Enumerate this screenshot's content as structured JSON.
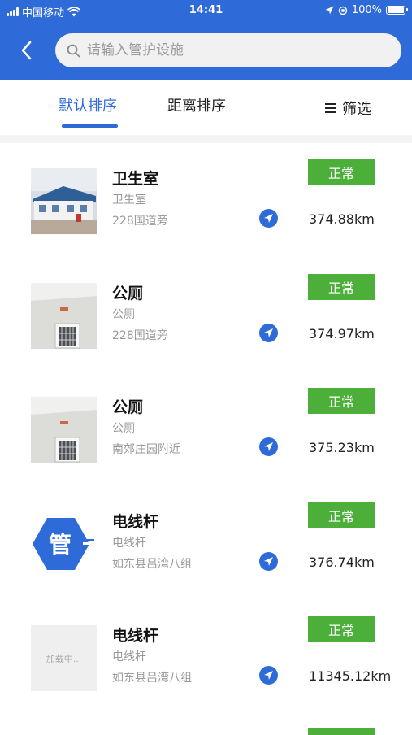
{
  "status_bar": {
    "carrier": "中国移动",
    "time": "14:41",
    "battery": "100%"
  },
  "header": {
    "back_icon": "chevron-left-icon",
    "search_icon": "search-icon",
    "search_placeholder": "请输入管护设施"
  },
  "tabs": {
    "default_sort": "默认排序",
    "distance_sort": "距离排序",
    "filter_label": "筛选",
    "active": "default_sort"
  },
  "colors": {
    "primary": "#2f6bd8",
    "status_green": "#4caf3a"
  },
  "facilities": [
    {
      "name": "卫生室",
      "type": "卫生室",
      "location": "228国道旁",
      "status": "正常",
      "distance": "374.88km",
      "thumb": "building-photo"
    },
    {
      "name": "公厕",
      "type": "公厕",
      "location": "228国道旁",
      "status": "正常",
      "distance": "374.97km",
      "thumb": "toilet-photo"
    },
    {
      "name": "公厕",
      "type": "公厕",
      "location": "南郊庄园附近",
      "status": "正常",
      "distance": "375.23km",
      "thumb": "toilet-photo"
    },
    {
      "name": "电线杆",
      "type": "电线杆",
      "location": "如东县吕湾八组",
      "status": "正常",
      "distance": "376.74km",
      "thumb": "logo"
    },
    {
      "name": "电线杆",
      "type": "电线杆",
      "location": "如东县吕湾八组",
      "status": "正常",
      "distance": "11345.12km",
      "thumb": "loading",
      "thumb_text": "加载中..."
    }
  ],
  "logo_text": "管"
}
